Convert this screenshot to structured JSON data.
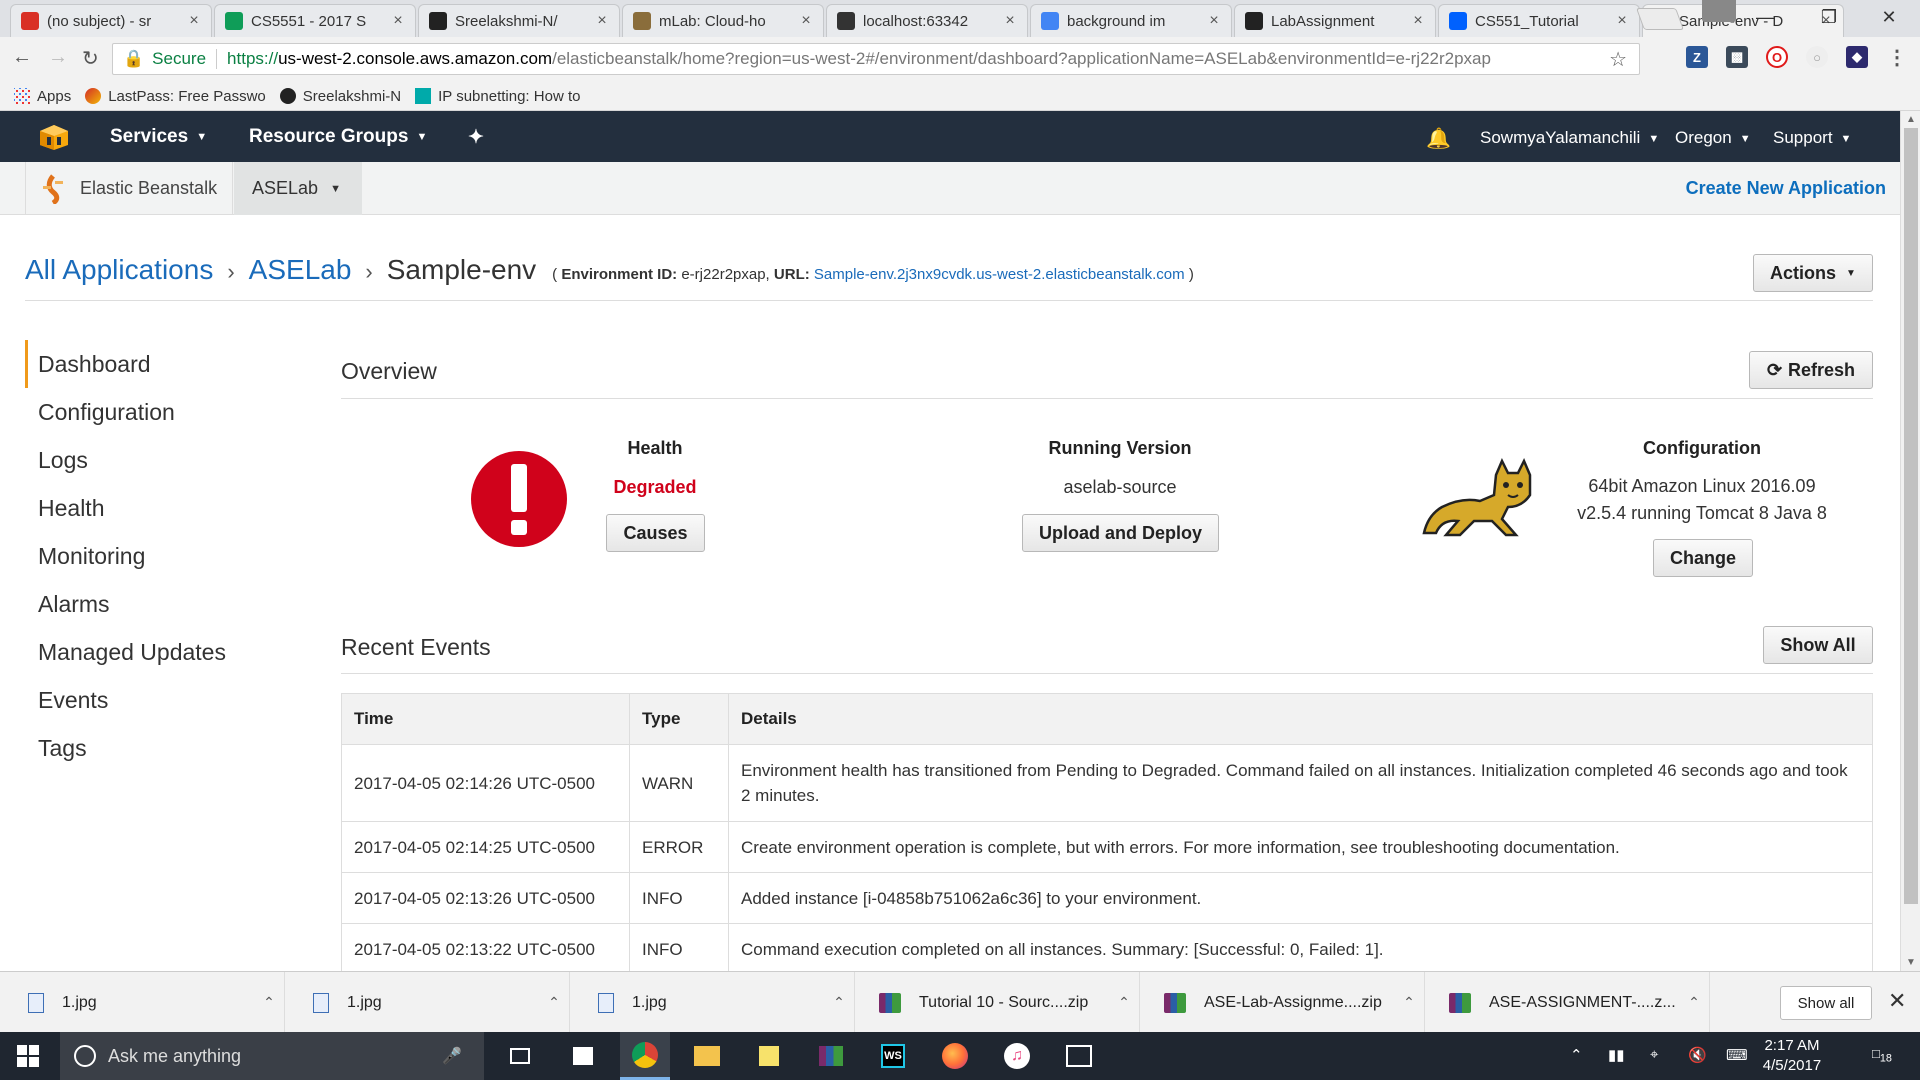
{
  "browser": {
    "tabs": [
      {
        "title": "(no subject) - sr",
        "favicon": "gmail-icon",
        "color": "#d93025"
      },
      {
        "title": "CS5551 - 2017 S",
        "favicon": "sheets-icon",
        "color": "#0f9d58"
      },
      {
        "title": "Sreelakshmi-N/",
        "favicon": "github-icon",
        "color": "#222222"
      },
      {
        "title": "mLab: Cloud-ho",
        "favicon": "mlab-icon",
        "color": "#8a6d3b"
      },
      {
        "title": "localhost:63342",
        "favicon": "webstorm-icon",
        "color": "#333333"
      },
      {
        "title": "background im",
        "favicon": "google-icon",
        "color": "#4285f4"
      },
      {
        "title": "LabAssignment",
        "favicon": "github-icon",
        "color": "#222222"
      },
      {
        "title": "CS551_Tutorial",
        "favicon": "dropbox-icon",
        "color": "#0061fe"
      },
      {
        "title": "Sample-env - D",
        "favicon": "aws-icon",
        "color": "#f7a80d"
      }
    ],
    "address": {
      "secure_label": "Secure",
      "url_scheme": "https://",
      "url_host": "us-west-2.console.aws.amazon.com",
      "url_path": "/elasticbeanstalk/home?region=us-west-2#/environment/dashboard?applicationName=ASELab&environmentId=e-rj22r2pxap"
    },
    "bookmarks": [
      {
        "label": "Apps",
        "icon": "apps-grid-icon"
      },
      {
        "label": "LastPass: Free Passwo",
        "icon": "lastpass-icon"
      },
      {
        "label": "Sreelakshmi-N",
        "icon": "github-icon"
      },
      {
        "label": "IP subnetting: How to",
        "icon": "bookmark-square-icon"
      }
    ]
  },
  "aws_nav": {
    "services": "Services",
    "resource_groups": "Resource Groups",
    "user": "SowmyaYalamanchili",
    "region": "Oregon",
    "support": "Support"
  },
  "subnav": {
    "service": "Elastic Beanstalk",
    "application": "ASELab",
    "create_new": "Create New Application"
  },
  "breadcrumb": {
    "all_apps": "All Applications",
    "app": "ASELab",
    "env": "Sample-env",
    "meta_open": "(",
    "env_id_label": "Environment ID:",
    "env_id": "e-rj22r2pxap,",
    "url_label": "URL:",
    "url": "Sample-env.2j3nx9cvdk.us-west-2.elasticbeanstalk.com",
    "meta_close": ")"
  },
  "actions_label": "Actions",
  "left_nav": [
    "Dashboard",
    "Configuration",
    "Logs",
    "Health",
    "Monitoring",
    "Alarms",
    "Managed Updates",
    "Events",
    "Tags"
  ],
  "overview": {
    "title": "Overview",
    "refresh": "Refresh",
    "health_label": "Health",
    "health_value": "Degraded",
    "causes": "Causes",
    "running_version_label": "Running Version",
    "running_version": "aselab-source",
    "upload_deploy": "Upload and Deploy",
    "configuration_label": "Configuration",
    "config_line1": "64bit Amazon Linux 2016.09",
    "config_line2": "v2.5.4 running Tomcat 8 Java 8",
    "change": "Change"
  },
  "events": {
    "title": "Recent Events",
    "show_all": "Show All",
    "columns": [
      "Time",
      "Type",
      "Details"
    ],
    "rows": [
      {
        "time": "2017-04-05 02:14:26 UTC-0500",
        "type": "WARN",
        "details": "Environment health has transitioned from Pending to Degraded. Command failed on all instances. Initialization completed 46 seconds ago and took 2 minutes."
      },
      {
        "time": "2017-04-05 02:14:25 UTC-0500",
        "type": "ERROR",
        "details": "Create environment operation is complete, but with errors. For more information, see troubleshooting documentation."
      },
      {
        "time": "2017-04-05 02:13:26 UTC-0500",
        "type": "INFO",
        "details": "Added instance [i-04858b751062a6c36] to your environment."
      },
      {
        "time": "2017-04-05 02:13:22 UTC-0500",
        "type": "INFO",
        "details": "Command execution completed on all instances. Summary: [Successful: 0, Failed: 1]."
      }
    ]
  },
  "downloads": {
    "items": [
      {
        "name": "1.jpg",
        "kind": "image"
      },
      {
        "name": "1.jpg",
        "kind": "image"
      },
      {
        "name": "1.jpg",
        "kind": "image"
      },
      {
        "name": "Tutorial 10 - Sourc....zip",
        "kind": "zip"
      },
      {
        "name": "ASE-Lab-Assignme....zip",
        "kind": "zip"
      },
      {
        "name": "ASE-ASSIGNMENT-....z...",
        "kind": "zip"
      }
    ],
    "show_all": "Show all"
  },
  "taskbar": {
    "search_placeholder": "Ask me anything",
    "time": "2:17 AM",
    "date": "4/5/2017",
    "notifications": "18"
  },
  "colors": {
    "aws_nav": "#232f3e",
    "link": "#1a6bba",
    "accent": "#f09a1b",
    "error": "#d0021b",
    "warn": "#e07b00",
    "info": "#3a8d1f"
  }
}
